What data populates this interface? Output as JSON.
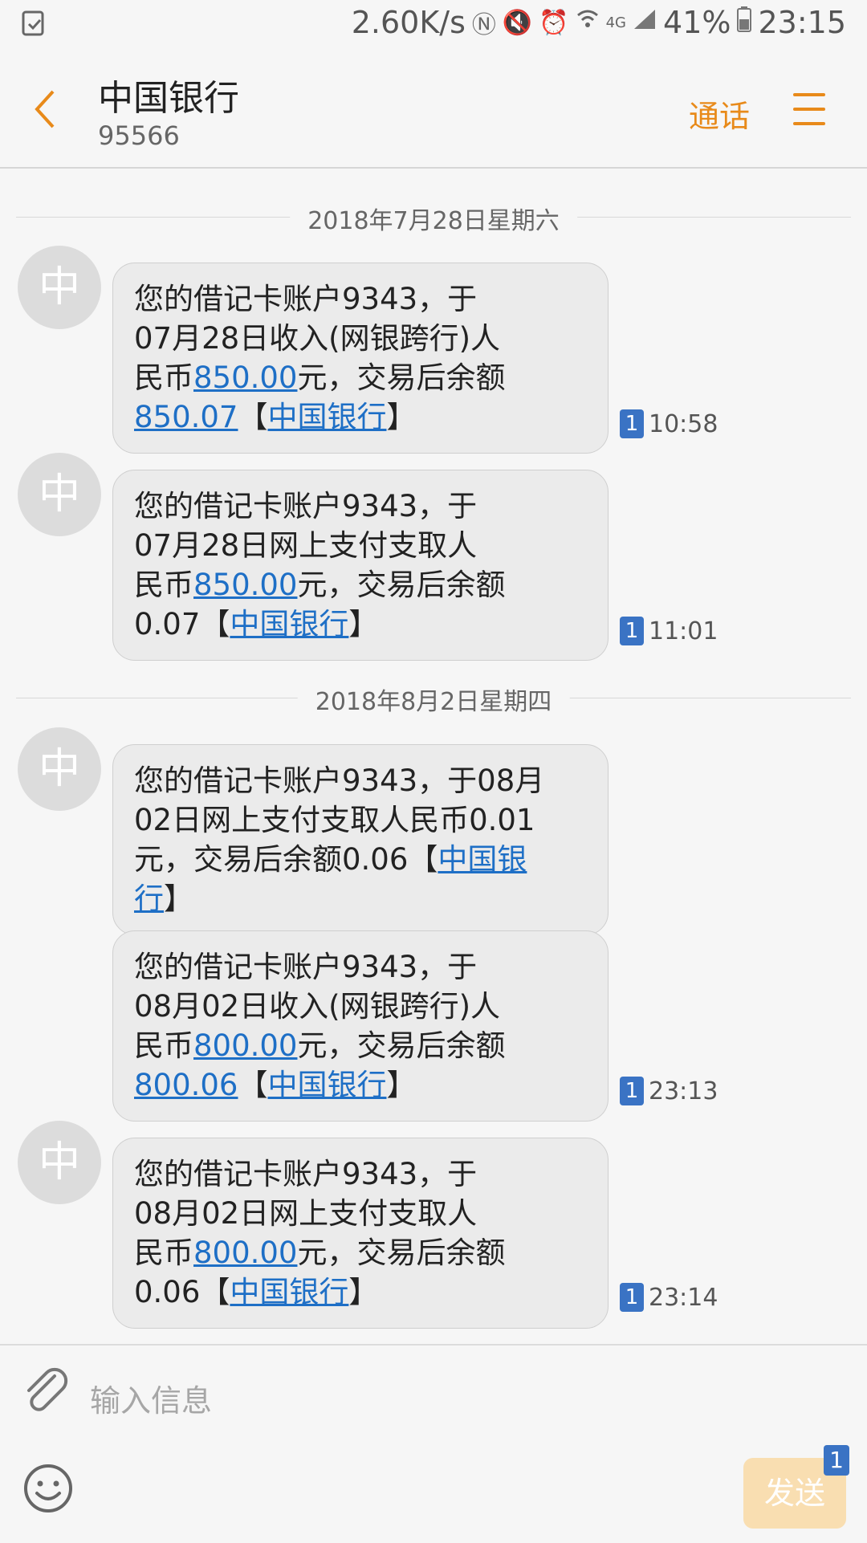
{
  "status_bar": {
    "speed": "2.60K/s",
    "network": "4G",
    "battery": "41%",
    "time": "23:15"
  },
  "header": {
    "title": "中国银行",
    "subtitle": "95566",
    "call_label": "通话"
  },
  "avatar_letter": "中",
  "dates": [
    "2018年7月28日星期六",
    "2018年8月2日星期四"
  ],
  "messages": [
    {
      "parts": [
        "您的借记卡账户9343，于",
        "07月28日收入(网银跨行)人",
        "民币",
        "850.00",
        "元，交易后余额",
        "850.07",
        "【",
        "中国银行",
        "】"
      ],
      "sim": "1",
      "time": "10:58"
    },
    {
      "parts": [
        "您的借记卡账户9343，于",
        "07月28日网上支付支取人",
        "民币",
        "850.00",
        "元，交易后余额",
        "0.07【",
        "中国银行",
        "】"
      ],
      "sim": "1",
      "time": "11:01"
    },
    {
      "parts": [
        "您的借记卡账户9343，于08月",
        "02日网上支付支取人民币0.01",
        "元，交易后余额0.06【",
        "中国银",
        "行",
        "】"
      ]
    },
    {
      "parts": [
        "您的借记卡账户9343，于",
        "08月02日收入(网银跨行)人",
        "民币",
        "800.00",
        "元，交易后余额",
        "800.06",
        "【",
        "中国银行",
        "】"
      ],
      "sim": "1",
      "time": "23:13"
    },
    {
      "parts": [
        "您的借记卡账户9343，于",
        "08月02日网上支付支取人",
        "民币",
        "800.00",
        "元，交易后余额",
        "0.06【",
        "中国银行",
        "】"
      ],
      "sim": "1",
      "time": "23:14"
    }
  ],
  "composer": {
    "placeholder": "输入信息",
    "send_label": "发送",
    "send_sim": "1"
  },
  "colors": {
    "accent": "#e88a1a",
    "link": "#1e6fc6",
    "sim_badge": "#3a73c4",
    "bubble_bg": "#ebebeb",
    "send_bg": "#f9deb1"
  }
}
